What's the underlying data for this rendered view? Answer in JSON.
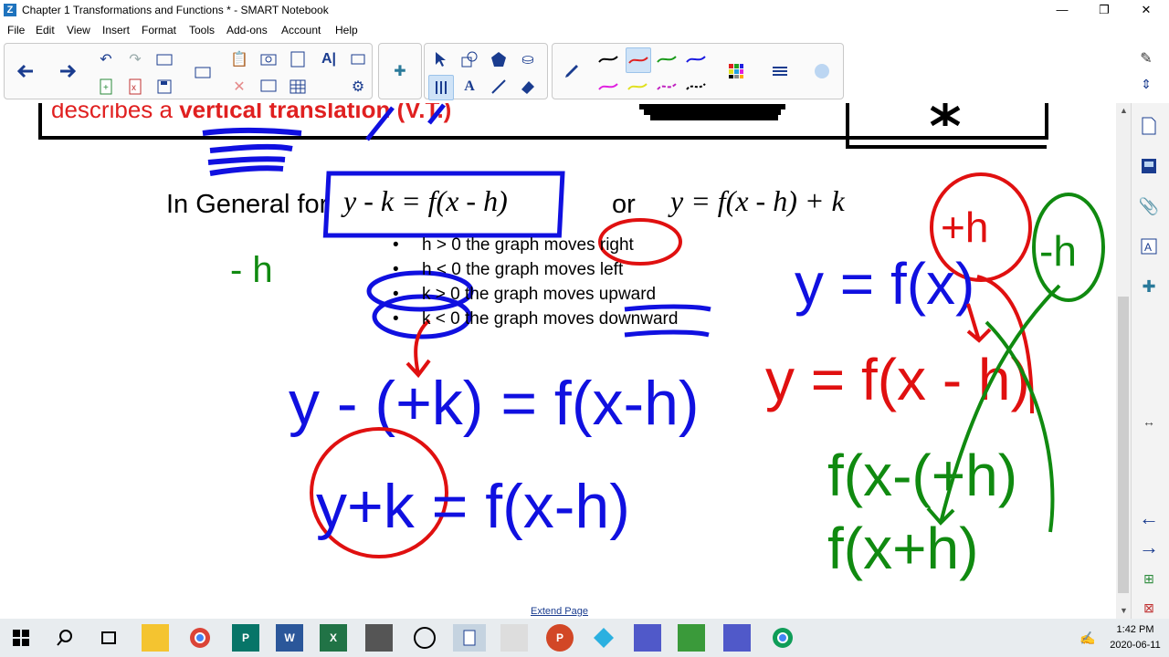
{
  "window": {
    "title": "Chapter 1 Transformations and Functions * - SMART Notebook",
    "app_icon_letter": "Z",
    "controls": {
      "minimize": "—",
      "restore": "❐",
      "close": "✕"
    }
  },
  "menu": [
    "File",
    "Edit",
    "View",
    "Insert",
    "Format",
    "Tools",
    "Add-ons",
    "Account",
    "Help"
  ],
  "toolbar": {
    "icons": [
      "back-icon",
      "forward-icon",
      "undo-icon",
      "redo-icon",
      "add-page-icon",
      "delete-page-icon",
      "save-icon",
      "screen-share-icon",
      "paste-icon",
      "delete-icon",
      "screen-capture-icon",
      "document-camera-icon",
      "full-screen-icon",
      "text-recognition-icon",
      "table-icon",
      "add-on-icon",
      "select-icon",
      "shapes-icon",
      "fill-icon",
      "pen-tool-icon",
      "text-icon",
      "line-icon",
      "eraser-icon",
      "pen-icon",
      "color-swatches-icon",
      "properties-icon",
      "lesson-activity-icon"
    ],
    "pen_colors": [
      "#000000",
      "#e02020",
      "#1a9a1a",
      "#1a1ae0",
      "#e020e0",
      "#e0e020",
      "#c020c0",
      "#000000"
    ],
    "selected_pen_color": "#e02020"
  },
  "slide": {
    "heading_fragment": "describes a",
    "heading_bold": "vertical translation (V.T.)",
    "general_label": "In General for",
    "equation_left": "y - k = f(x - h)",
    "or_label": "or",
    "equation_right": "y = f(x - h) + k",
    "bullets": [
      "h > 0 the graph moves right",
      "h < 0 the graph moves left",
      "k > 0 the graph moves upward",
      "k < 0 the graph moves downward"
    ],
    "heading_color": "#e02020"
  },
  "handwriting": {
    "minus_h_left": "- h",
    "plus_h_circle": "+h",
    "minus_h_circle": "-h",
    "blue_line1": "y - (+k) = f(x-h)",
    "blue_line2": "y+k = f(x-h)",
    "blue_right": "y = f(x)",
    "red_right": "y = f(x - h)",
    "green_line1": "f(x-(+h)",
    "green_line2": "f(x+h)",
    "ink_colors": {
      "blue": "#1010e0",
      "red": "#e01010",
      "green": "#108a10"
    }
  },
  "canvas": {
    "extend_page": "Extend Page"
  },
  "side_tabs": [
    "page-sorter-icon",
    "gallery-icon",
    "attachments-icon",
    "properties-icon",
    "add-ons-icon"
  ],
  "side_nav": [
    "previous-page-icon",
    "next-page-icon",
    "add-page-icon",
    "delete-page-icon"
  ],
  "taskbar": {
    "apps": [
      "start-icon",
      "search-icon",
      "task-view-icon",
      "file-explorer-icon",
      "chrome-icon",
      "publisher-icon",
      "word-icon",
      "excel-icon",
      "app-icon",
      "browser-icon",
      "notebook-icon",
      "calculator-icon",
      "powerpoint-icon",
      "vpn-icon",
      "teams-icon",
      "app-icon-2",
      "teams-icon-2",
      "chrome-icon-2"
    ],
    "app_labels": [
      "P",
      "W",
      "X",
      "P"
    ],
    "time": "1:42 PM",
    "date": "2020-06-11"
  }
}
